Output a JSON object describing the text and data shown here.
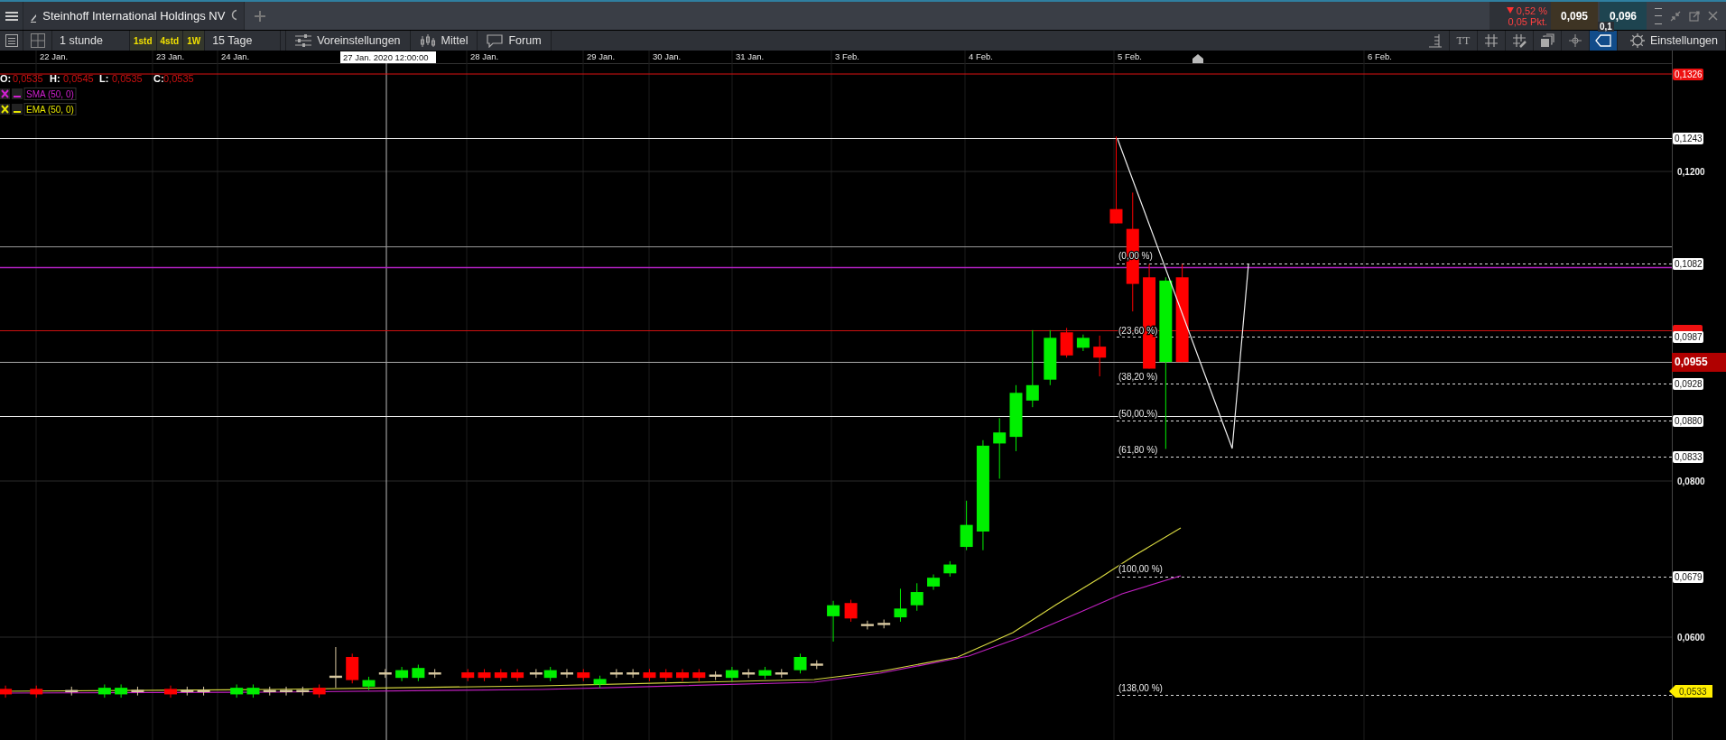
{
  "top_bar": {
    "instrument_title": "Steinhoff International Holdings NV",
    "quote": {
      "change_percent": "0,52 %",
      "change_points": "0,05 Pkt.",
      "bid": "0,095",
      "ask": "0,096",
      "spread": "0,1"
    }
  },
  "toolbar": {
    "interval": "1 stunde",
    "interval_presets": [
      {
        "label": "1std"
      },
      {
        "label": "4std"
      },
      {
        "label": "1W"
      }
    ],
    "range": "15 Tage",
    "buttons": [
      {
        "label": "Voreinstellungen",
        "kind": "presets"
      },
      {
        "label": "Mittel",
        "kind": "indicators"
      },
      {
        "label": "Forum",
        "kind": "forum"
      }
    ],
    "tools": [
      {
        "kind": "scale",
        "selected": false
      },
      {
        "kind": "font",
        "label": "TT",
        "selected": false
      },
      {
        "kind": "grid",
        "selected": false
      },
      {
        "kind": "snap",
        "selected": false
      },
      {
        "kind": "layers",
        "selected": false
      },
      {
        "kind": "crosshair",
        "selected": false
      },
      {
        "kind": "tag",
        "selected": true
      }
    ],
    "settings_label": "Einstellungen"
  },
  "chart": {
    "time_axis": [
      "22 Jan.",
      "23 Jan.",
      "24 Jan.",
      "28 Jan.",
      "29 Jan.",
      "30 Jan.",
      "31 Jan.",
      "3 Feb.",
      "4 Feb.",
      "5 Feb.",
      "6 Feb."
    ],
    "crosshair_time": "27 Jan. 2020 12:00:00",
    "ohlc": [
      {
        "label": "O:",
        "value": "0,0535"
      },
      {
        "label": "H:",
        "value": "0,0545"
      },
      {
        "label": "L:",
        "value": "0,0535"
      },
      {
        "label": "C:",
        "value": "0,0535"
      }
    ],
    "indicators": [
      {
        "name": "SMA (50, 0)",
        "color": "#d020d0"
      },
      {
        "name": "EMA (50, 0)",
        "color": "#e6e600"
      }
    ],
    "price_axis": [
      "0,1200",
      "0,0800",
      "0,0600"
    ],
    "price_tags": [
      {
        "value": "0,1326",
        "kind": "alert"
      },
      {
        "value": "0,1243",
        "kind": "level"
      },
      {
        "value": "0,1082",
        "kind": "level"
      },
      {
        "value": "0,0987",
        "kind": "level"
      },
      {
        "value": "0,0955",
        "kind": "last"
      },
      {
        "value": "0,0928",
        "kind": "level"
      },
      {
        "value": "0,0880",
        "kind": "level"
      },
      {
        "value": "0,0833",
        "kind": "level"
      },
      {
        "value": "0,0679",
        "kind": "level"
      },
      {
        "value": "0,0533",
        "kind": "marker"
      }
    ],
    "fibonacci_levels": [
      "(0,00 %)",
      "(23,60 %)",
      "(38,20 %)",
      "(50,00 %)",
      "(61,80 %)",
      "(100,00 %)",
      "(138,00 %)"
    ]
  }
}
